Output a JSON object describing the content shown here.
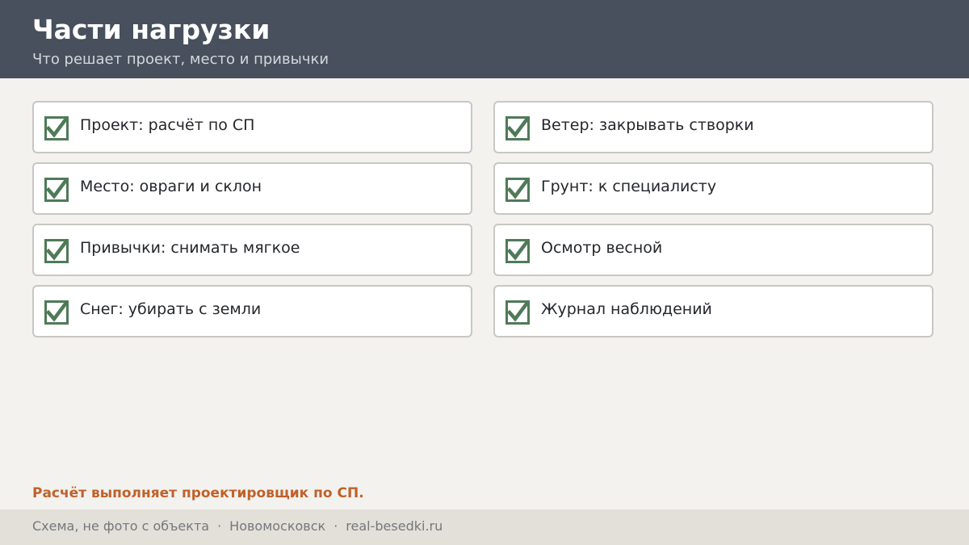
{
  "header": {
    "title": "Части нагрузки",
    "subtitle": "Что решает проект, место и привычки"
  },
  "checklist": {
    "check_color": "#4f7a58",
    "left": [
      {
        "label": "Проект: расчёт по СП",
        "checked": true
      },
      {
        "label": "Место: овраги и склон",
        "checked": true
      },
      {
        "label": "Привычки: снимать мягкое",
        "checked": true
      },
      {
        "label": "Снег: убирать с земли",
        "checked": true
      }
    ],
    "right": [
      {
        "label": "Ветер: закрывать створки",
        "checked": true
      },
      {
        "label": "Грунт: к специалисту",
        "checked": true
      },
      {
        "label": "Осмотр весной",
        "checked": true
      },
      {
        "label": "Журнал наблюдений",
        "checked": true
      }
    ]
  },
  "note": {
    "text": "Расчёт выполняет проектировщик по СП.",
    "color": "#c0612b"
  },
  "footer": {
    "caption": "Схема, не фото с объекта",
    "separator": "·",
    "city": "Новомосковск",
    "site": "real-besedki.ru"
  }
}
